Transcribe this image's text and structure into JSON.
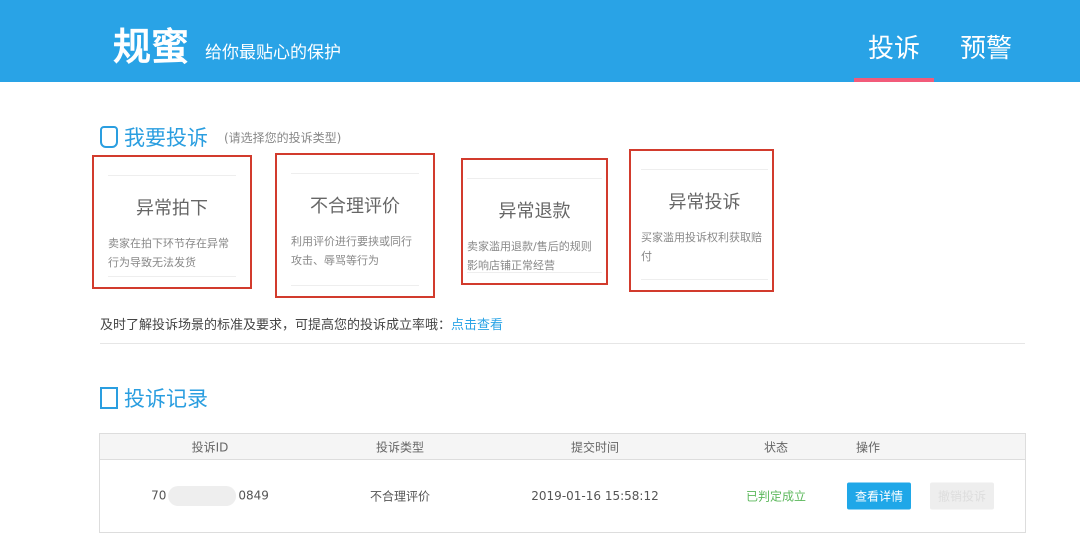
{
  "header": {
    "logo": "规蜜",
    "slogan": "给你最贴心的保护",
    "nav": [
      {
        "label": "投诉",
        "active": true
      },
      {
        "label": "预警",
        "active": false
      }
    ]
  },
  "complain": {
    "title": "我要投诉",
    "subtitle": "(请选择您的投诉类型)",
    "cards": [
      {
        "title": "异常拍下",
        "desc": "卖家在拍下环节存在异常行为导致无法发货"
      },
      {
        "title": "不合理评价",
        "desc": "利用评价进行要挟或同行攻击、辱骂等行为"
      },
      {
        "title": "异常退款",
        "desc": "卖家滥用退款/售后的规则影响店铺正常经营"
      },
      {
        "title": "异常投诉",
        "desc": "买家滥用投诉权利获取赔付"
      }
    ],
    "note": "及时了解投诉场景的标准及要求，可提高您的投诉成立率哦：",
    "note_link": "点击查看"
  },
  "records": {
    "title": "投诉记录",
    "columns": [
      "投诉ID",
      "投诉类型",
      "提交时间",
      "状态",
      "操作"
    ],
    "rows": [
      {
        "id_prefix": "70",
        "id_suffix": "0849",
        "type": "不合理评价",
        "time": "2019-01-16 15:58:12",
        "status": "已判定成立",
        "action_primary": "查看详情",
        "action_secondary": "撤销投诉"
      }
    ]
  },
  "colors": {
    "brand": "#29a3e6",
    "highlight": "#d23b2d",
    "status_ok": "#5cb85c"
  }
}
